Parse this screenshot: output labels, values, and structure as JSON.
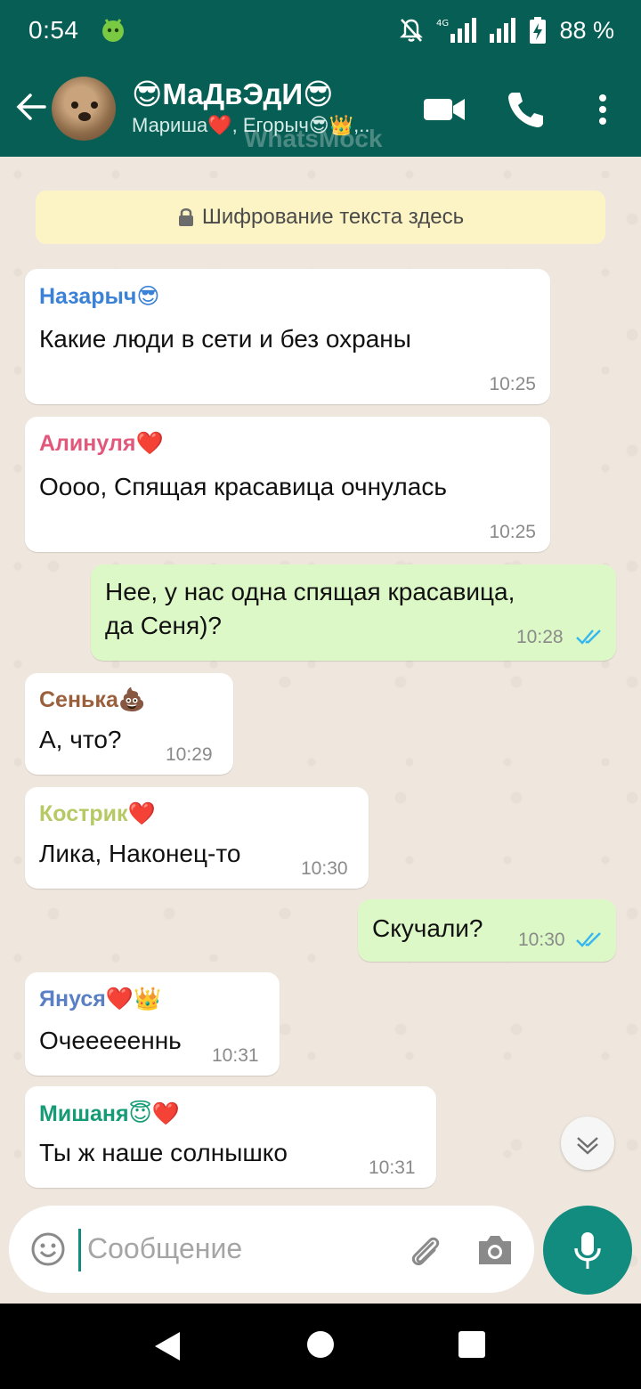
{
  "status_bar": {
    "time": "0:54",
    "battery": "88 %",
    "network": "4G"
  },
  "header": {
    "title": "😎МаДвЭдИ😎",
    "subtitle": "Мариша❤️, Егорыч😎👑,..",
    "watermark": "WhatsMock"
  },
  "encryption_notice": "Шифрование текста здесь",
  "messages": [
    {
      "sender": "Назарыч😎",
      "sender_color": "#3b82d6",
      "text": "Какие люди в сети и без охраны",
      "time": "10:25"
    },
    {
      "sender": "Алинуля❤️",
      "sender_color": "#e2587a",
      "text": "Оооо, Спящая красавица очнулась",
      "time": "10:25"
    },
    {
      "outgoing": true,
      "text_line1": "Нее, у нас одна спящая красавица,",
      "text_line2": "да Сеня)?",
      "time": "10:28"
    },
    {
      "sender": "Сенька💩",
      "sender_color": "#9c5f3c",
      "text": "А, что?",
      "time": "10:29"
    },
    {
      "sender": "Кострик❤️",
      "sender_color": "#b5c965",
      "text": "Лика, Наконец-то",
      "time": "10:30"
    },
    {
      "outgoing": true,
      "text": "Скучали?",
      "time": "10:30"
    },
    {
      "sender": "Януся❤️👑",
      "sender_color": "#5b7fc5",
      "text": "Очеееееннь",
      "time": "10:31"
    },
    {
      "sender": "Мишаня😇❤️",
      "sender_color": "#159c76",
      "text": "Ты ж наше солнышко",
      "time": "10:31"
    }
  ],
  "composer": {
    "placeholder": "Сообщение"
  },
  "colors": {
    "header": "#075e54",
    "accent": "#128c7e",
    "outgoing_bubble": "#dcf8c6",
    "read_ticks": "#34b7f1"
  }
}
